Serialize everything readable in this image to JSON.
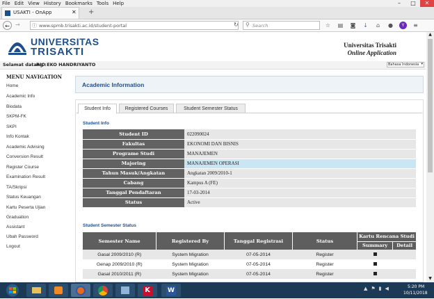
{
  "menubar": {
    "items": [
      "File",
      "Edit",
      "View",
      "History",
      "Bookmarks",
      "Tools",
      "Help"
    ]
  },
  "browser": {
    "tab_title": "USAKTI - OnApp",
    "url": "www.spmb.trisakti.ac.id/student-portal",
    "search_placeholder": "Search"
  },
  "header": {
    "logo_line1": "UNIVERSITAS",
    "logo_line2": "TRISAKTI",
    "right_title": "Universitas Trisakti",
    "right_subtitle": "Online Application"
  },
  "welcome": {
    "prefix": "Selamat datang :",
    "name": "RIO EKO HANDRIYANTO",
    "language": "Bahasa Indonesia"
  },
  "sidebar": {
    "title": "MENU NAVIGATION",
    "items": [
      "Home",
      "Academic Info",
      "Biodata",
      "SKPM-FK",
      "SKPI",
      "Info Kontak",
      "Academic Advising",
      "Conversion Result",
      "Register Course",
      "Examination Result",
      "TA/Skripsi",
      "Status Keuangan",
      "Kartu Peserta Ujian",
      "Graduation",
      "Assistant",
      "Ubah Password",
      "Logout"
    ]
  },
  "main": {
    "title": "Academic Information",
    "tabs": [
      "Student Info",
      "Registered Courses",
      "Student Semester Status"
    ],
    "student_info": {
      "heading": "Student Info",
      "rows": [
        {
          "label": "Student ID",
          "value": "022090024"
        },
        {
          "label": "Fakultas",
          "value": "EKONOMI DAN BISNIS"
        },
        {
          "label": "Programe Studi",
          "value": "MANAJEMEN"
        },
        {
          "label": "Majoring",
          "value": "MANAJEMEN OPERASI"
        },
        {
          "label": "Tahun Masuk/Angkatan",
          "value": "Angkatan 2009/2010-1"
        },
        {
          "label": "Cabang",
          "value": "Kampus A (FE)"
        },
        {
          "label": "Tanggal Pendaftaran",
          "value": "17-03-2014"
        },
        {
          "label": "Status",
          "value": "Active"
        }
      ]
    },
    "semester_status": {
      "heading": "Student Semester Status",
      "columns": [
        "Semester Name",
        "Registered By",
        "Tanggal Registrasi",
        "Status",
        "Kartu Rencana Studi",
        "Summary",
        "Detail"
      ],
      "rows": [
        {
          "semester": "Gasal 2009/2010 (R)",
          "by": "System Migration",
          "date": "07-05-2014",
          "status": "Register"
        },
        {
          "semester": "Genap 2009/2010 (R)",
          "by": "System Migration",
          "date": "07-05-2014",
          "status": "Register"
        },
        {
          "semester": "Gasal 2010/2011 (R)",
          "by": "System Migration",
          "date": "07-05-2014",
          "status": "Register"
        }
      ]
    }
  },
  "taskbar": {
    "time": "5:20 PM",
    "date": "10/11/2018"
  },
  "colors": {
    "accent": "#1f4e8c",
    "highlight": "#c9e6f5",
    "label_bg": "#626262",
    "taskbar": "#1c3a56"
  }
}
